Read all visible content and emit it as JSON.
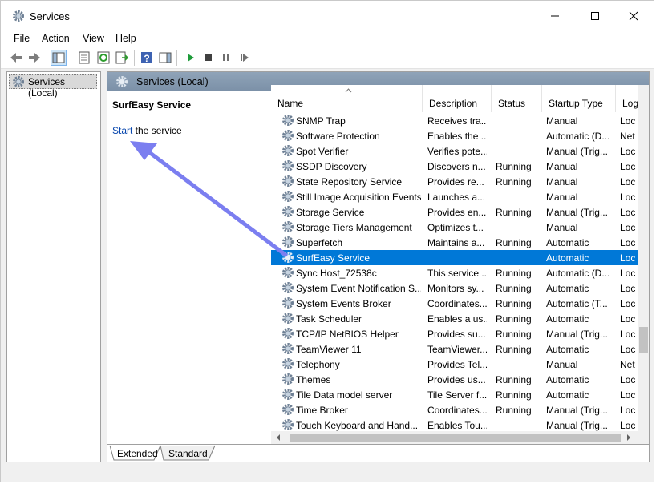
{
  "window": {
    "title": "Services",
    "app_icon": "gear-icon"
  },
  "menu": [
    "File",
    "Action",
    "View",
    "Help"
  ],
  "toolbar": {
    "buttons": [
      "back-icon",
      "forward-icon",
      "console-tree-icon",
      "properties-icon",
      "refresh-icon",
      "export-icon",
      "help-icon",
      "action-pane-icon",
      "play-icon",
      "stop-icon",
      "pause-icon",
      "restart-icon"
    ]
  },
  "tree": {
    "root_label": "Services (Local)"
  },
  "main": {
    "header_title": "Services (Local)",
    "selected_service": "SurfEasy Service",
    "action_link": "Start",
    "action_suffix": " the service"
  },
  "columns": [
    "Name",
    "Description",
    "Status",
    "Startup Type",
    "Log"
  ],
  "services": [
    {
      "name": "SNMP Trap",
      "description": "Receives tra...",
      "status": "",
      "startup": "Manual",
      "logon": "Loc"
    },
    {
      "name": "Software Protection",
      "description": "Enables the ...",
      "status": "",
      "startup": "Automatic (D...",
      "logon": "Net"
    },
    {
      "name": "Spot Verifier",
      "description": "Verifies pote...",
      "status": "",
      "startup": "Manual (Trig...",
      "logon": "Loc"
    },
    {
      "name": "SSDP Discovery",
      "description": "Discovers n...",
      "status": "Running",
      "startup": "Manual",
      "logon": "Loc"
    },
    {
      "name": "State Repository Service",
      "description": "Provides re...",
      "status": "Running",
      "startup": "Manual",
      "logon": "Loc"
    },
    {
      "name": "Still Image Acquisition Events",
      "description": "Launches a...",
      "status": "",
      "startup": "Manual",
      "logon": "Loc"
    },
    {
      "name": "Storage Service",
      "description": "Provides en...",
      "status": "Running",
      "startup": "Manual (Trig...",
      "logon": "Loc"
    },
    {
      "name": "Storage Tiers Management",
      "description": "Optimizes t...",
      "status": "",
      "startup": "Manual",
      "logon": "Loc"
    },
    {
      "name": "Superfetch",
      "description": "Maintains a...",
      "status": "Running",
      "startup": "Automatic",
      "logon": "Loc"
    },
    {
      "name": "SurfEasy Service",
      "description": "",
      "status": "",
      "startup": "Automatic",
      "logon": "Loc"
    },
    {
      "name": "Sync Host_72538c",
      "description": "This service ...",
      "status": "Running",
      "startup": "Automatic (D...",
      "logon": "Loc"
    },
    {
      "name": "System Event Notification S...",
      "description": "Monitors sy...",
      "status": "Running",
      "startup": "Automatic",
      "logon": "Loc"
    },
    {
      "name": "System Events Broker",
      "description": "Coordinates...",
      "status": "Running",
      "startup": "Automatic (T...",
      "logon": "Loc"
    },
    {
      "name": "Task Scheduler",
      "description": "Enables a us...",
      "status": "Running",
      "startup": "Automatic",
      "logon": "Loc"
    },
    {
      "name": "TCP/IP NetBIOS Helper",
      "description": "Provides su...",
      "status": "Running",
      "startup": "Manual (Trig...",
      "logon": "Loc"
    },
    {
      "name": "TeamViewer 11",
      "description": "TeamViewer...",
      "status": "Running",
      "startup": "Automatic",
      "logon": "Loc"
    },
    {
      "name": "Telephony",
      "description": "Provides Tel...",
      "status": "",
      "startup": "Manual",
      "logon": "Net"
    },
    {
      "name": "Themes",
      "description": "Provides us...",
      "status": "Running",
      "startup": "Automatic",
      "logon": "Loc"
    },
    {
      "name": "Tile Data model server",
      "description": "Tile Server f...",
      "status": "Running",
      "startup": "Automatic",
      "logon": "Loc"
    },
    {
      "name": "Time Broker",
      "description": "Coordinates...",
      "status": "Running",
      "startup": "Manual (Trig...",
      "logon": "Loc"
    },
    {
      "name": "Touch Keyboard and Hand...",
      "description": "Enables Tou...",
      "status": "",
      "startup": "Manual (Trig...",
      "logon": "Loc"
    }
  ],
  "selected_index": 9,
  "tabs": [
    "Extended",
    "Standard"
  ],
  "active_tab": "Extended",
  "colors": {
    "selection": "#0078d7",
    "header_bar": "#8fa3b8",
    "annotation_arrow": "#7b7ef0",
    "link": "#0645ad"
  }
}
